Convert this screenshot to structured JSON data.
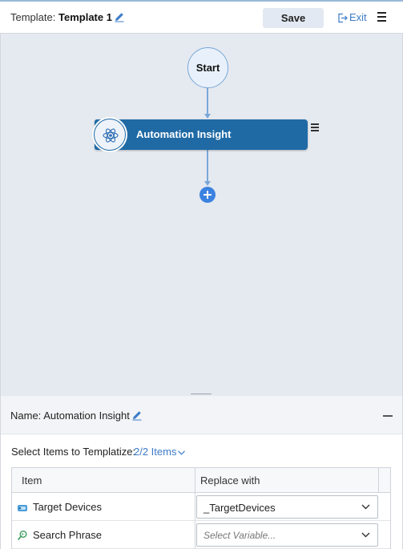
{
  "header": {
    "template_prefix": "Template:",
    "template_name": "Template 1",
    "save_label": "Save",
    "exit_label": "Exit"
  },
  "flow": {
    "start_label": "Start",
    "action_label": "Automation Insight"
  },
  "panel": {
    "name_prefix": "Name:",
    "name_value": "Automation Insight",
    "select_label": "Select Items to Templatize:",
    "items_count": "2/2 Items",
    "columns": [
      "Item",
      "Replace with"
    ],
    "rows": [
      {
        "item": "Target Devices",
        "replace": "_TargetDevices",
        "icon": "target-devices-icon"
      },
      {
        "item": "Search Phrase",
        "replace_placeholder": "Select Variable...",
        "icon": "search-phrase-icon"
      }
    ]
  },
  "colors": {
    "accent": "#3d7cc9",
    "node_blue": "#1f6aa5",
    "canvas_bg": "#e5e9f0",
    "add_button": "#3b82e0"
  }
}
